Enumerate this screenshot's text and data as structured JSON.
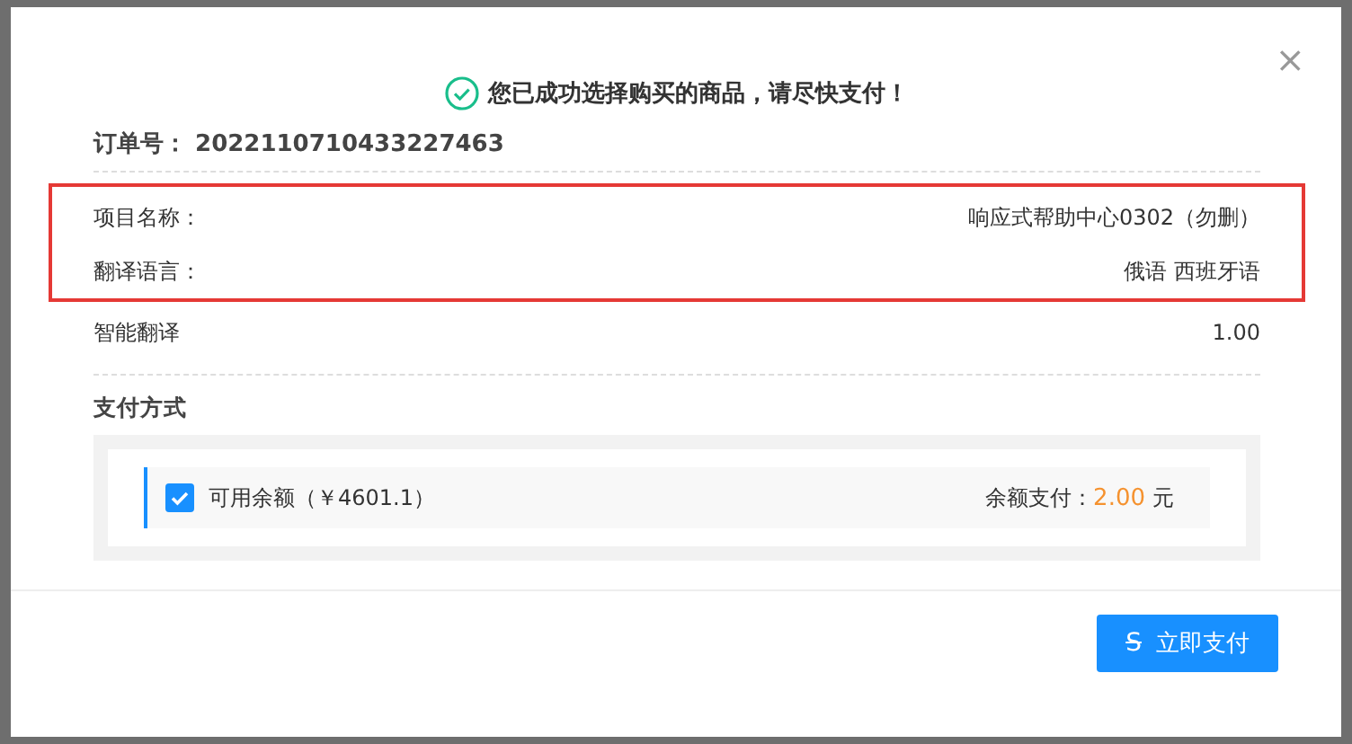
{
  "dialog": {
    "close_icon": "×",
    "headline": "您已成功选择购买的商品，请尽快支付！",
    "order_label": "订单号：",
    "order_number": "2022110710433227463"
  },
  "details": [
    {
      "label": "项目名称：",
      "value": "响应式帮助中心0302（勿删）",
      "highlighted": true
    },
    {
      "label": "翻译语言：",
      "value": "俄语 西班牙语",
      "highlighted": true
    },
    {
      "label": "智能翻译",
      "value": "1.00",
      "highlighted": false
    }
  ],
  "payment": {
    "title": "支付方式",
    "option_label": "可用余额（￥4601.1）",
    "checked": true,
    "amount_label": "余额支付：",
    "amount": "2.00",
    "unit": "元"
  },
  "pay_button": {
    "icon": "S",
    "label": "立即支付"
  }
}
